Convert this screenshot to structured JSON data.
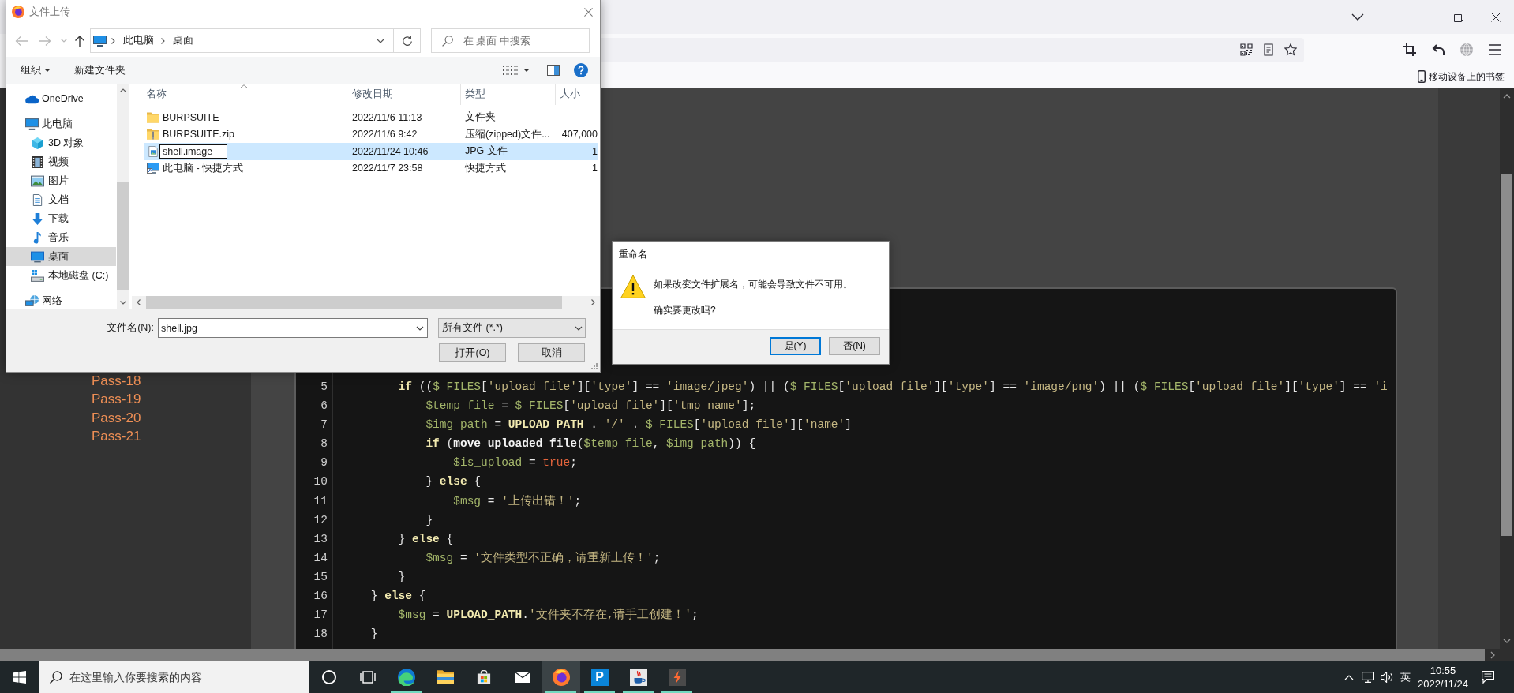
{
  "browser": {
    "bookmarks": [
      {
        "label": "移动设备上的书签"
      }
    ]
  },
  "page": {
    "sidebar": {
      "items": [
        {
          "label": "Pass-18"
        },
        {
          "label": "Pass-19"
        },
        {
          "label": "Pass-20"
        },
        {
          "label": "Pass-21"
        }
      ]
    },
    "code": {
      "lines": [
        {
          "number": "5",
          "tokens": [
            {
              "kind": "keyword",
              "text": "        if"
            },
            {
              "kind": "plain",
              "text": " (("
            },
            {
              "kind": "variable",
              "text": "$_FILES"
            },
            {
              "kind": "plain",
              "text": "["
            },
            {
              "kind": "string",
              "text": "'upload_file'"
            },
            {
              "kind": "plain",
              "text": "]["
            },
            {
              "kind": "string",
              "text": "'type'"
            },
            {
              "kind": "plain",
              "text": "] == "
            },
            {
              "kind": "string",
              "text": "'image/jpeg'"
            },
            {
              "kind": "plain",
              "text": ") || ("
            },
            {
              "kind": "variable",
              "text": "$_FILES"
            },
            {
              "kind": "plain",
              "text": "["
            },
            {
              "kind": "string",
              "text": "'upload_file'"
            },
            {
              "kind": "plain",
              "text": "]["
            },
            {
              "kind": "string",
              "text": "'type'"
            },
            {
              "kind": "plain",
              "text": "] == "
            },
            {
              "kind": "string",
              "text": "'image/png'"
            },
            {
              "kind": "plain",
              "text": ") || ("
            },
            {
              "kind": "variable",
              "text": "$_FILES"
            },
            {
              "kind": "plain",
              "text": "["
            },
            {
              "kind": "string",
              "text": "'upload_file'"
            },
            {
              "kind": "plain",
              "text": "]["
            },
            {
              "kind": "string",
              "text": "'type'"
            },
            {
              "kind": "plain",
              "text": "] == "
            },
            {
              "kind": "string",
              "text": "'i"
            }
          ]
        },
        {
          "number": "6",
          "tokens": [
            {
              "kind": "variable",
              "text": "            $temp_file"
            },
            {
              "kind": "plain",
              "text": " = "
            },
            {
              "kind": "variable",
              "text": "$_FILES"
            },
            {
              "kind": "plain",
              "text": "["
            },
            {
              "kind": "string",
              "text": "'upload_file'"
            },
            {
              "kind": "plain",
              "text": "]["
            },
            {
              "kind": "string",
              "text": "'tmp_name'"
            },
            {
              "kind": "plain",
              "text": "];"
            }
          ]
        },
        {
          "number": "7",
          "tokens": [
            {
              "kind": "variable",
              "text": "            $img_path"
            },
            {
              "kind": "plain",
              "text": " = "
            },
            {
              "kind": "constant",
              "text": "UPLOAD_PATH"
            },
            {
              "kind": "plain",
              "text": " . "
            },
            {
              "kind": "string",
              "text": "'/'"
            },
            {
              "kind": "plain",
              "text": " . "
            },
            {
              "kind": "variable",
              "text": "$_FILES"
            },
            {
              "kind": "plain",
              "text": "["
            },
            {
              "kind": "string",
              "text": "'upload_file'"
            },
            {
              "kind": "plain",
              "text": "]["
            },
            {
              "kind": "string",
              "text": "'name'"
            },
            {
              "kind": "plain",
              "text": "]"
            }
          ]
        },
        {
          "number": "8",
          "tokens": [
            {
              "kind": "keyword",
              "text": "            if"
            },
            {
              "kind": "plain",
              "text": " ("
            },
            {
              "kind": "function",
              "text": "move_uploaded_file"
            },
            {
              "kind": "plain",
              "text": "("
            },
            {
              "kind": "variable",
              "text": "$temp_file"
            },
            {
              "kind": "plain",
              "text": ", "
            },
            {
              "kind": "variable",
              "text": "$img_path"
            },
            {
              "kind": "plain",
              "text": ")) {"
            }
          ]
        },
        {
          "number": "9",
          "tokens": [
            {
              "kind": "variable",
              "text": "                $is_upload"
            },
            {
              "kind": "plain",
              "text": " = "
            },
            {
              "kind": "literal",
              "text": "true"
            },
            {
              "kind": "plain",
              "text": ";"
            }
          ]
        },
        {
          "number": "10",
          "tokens": [
            {
              "kind": "plain",
              "text": "            } "
            },
            {
              "kind": "keyword",
              "text": "else"
            },
            {
              "kind": "plain",
              "text": " {"
            }
          ]
        },
        {
          "number": "11",
          "tokens": [
            {
              "kind": "variable",
              "text": "                $msg"
            },
            {
              "kind": "plain",
              "text": " = "
            },
            {
              "kind": "string",
              "text": "'上传出错！'"
            },
            {
              "kind": "plain",
              "text": ";"
            }
          ]
        },
        {
          "number": "12",
          "tokens": [
            {
              "kind": "plain",
              "text": "            }"
            }
          ]
        },
        {
          "number": "13",
          "tokens": [
            {
              "kind": "plain",
              "text": "        } "
            },
            {
              "kind": "keyword",
              "text": "else"
            },
            {
              "kind": "plain",
              "text": " {"
            }
          ]
        },
        {
          "number": "14",
          "tokens": [
            {
              "kind": "variable",
              "text": "            $msg"
            },
            {
              "kind": "plain",
              "text": " = "
            },
            {
              "kind": "string",
              "text": "'文件类型不正确，请重新上传！'"
            },
            {
              "kind": "plain",
              "text": ";"
            }
          ]
        },
        {
          "number": "15",
          "tokens": [
            {
              "kind": "plain",
              "text": "        }"
            }
          ]
        },
        {
          "number": "16",
          "tokens": [
            {
              "kind": "plain",
              "text": "    } "
            },
            {
              "kind": "keyword",
              "text": "else"
            },
            {
              "kind": "plain",
              "text": " {"
            }
          ]
        },
        {
          "number": "17",
          "tokens": [
            {
              "kind": "variable",
              "text": "        $msg"
            },
            {
              "kind": "plain",
              "text": " = "
            },
            {
              "kind": "constant",
              "text": "UPLOAD_PATH"
            },
            {
              "kind": "plain",
              "text": "."
            },
            {
              "kind": "string",
              "text": "'文件夹不存在,请手工创建！'"
            },
            {
              "kind": "plain",
              "text": ";"
            }
          ]
        },
        {
          "number": "18",
          "tokens": [
            {
              "kind": "plain",
              "text": "    }"
            }
          ]
        }
      ]
    }
  },
  "file_dialog": {
    "title": "文件上传",
    "nav_buttons": [
      {
        "kind": "back",
        "disabled": true
      },
      {
        "kind": "forward",
        "disabled": true
      },
      {
        "kind": "recent",
        "disabled": true
      },
      {
        "kind": "up",
        "disabled": false
      }
    ],
    "breadcrumb": [
      {
        "label": "此电脑"
      },
      {
        "label": "桌面"
      }
    ],
    "search": {
      "placeholder": "在 桌面 中搜索"
    },
    "commands": [
      {
        "label": "组织",
        "menu": true
      },
      {
        "label": "新建文件夹",
        "menu": false
      }
    ],
    "nav": [
      {
        "label": "OneDrive",
        "kind": "cloud",
        "selected": false
      },
      {
        "label": "此电脑",
        "kind": "computer",
        "selected": false,
        "children": [
          {
            "label": "3D 对象",
            "kind": "cube",
            "selected": false
          },
          {
            "label": "视频",
            "kind": "video",
            "selected": false
          },
          {
            "label": "图片",
            "kind": "pictures",
            "selected": false
          },
          {
            "label": "文档",
            "kind": "documents",
            "selected": false
          },
          {
            "label": "下载",
            "kind": "downloads",
            "selected": false
          },
          {
            "label": "音乐",
            "kind": "music",
            "selected": false
          },
          {
            "label": "桌面",
            "kind": "desktop",
            "selected": true
          },
          {
            "label": "本地磁盘 (C:)",
            "kind": "drive",
            "selected": false
          }
        ]
      },
      {
        "label": "网络",
        "kind": "network",
        "selected": false
      }
    ],
    "columns": [
      {
        "label": "名称",
        "sorted": true
      },
      {
        "label": "修改日期",
        "sorted": false
      },
      {
        "label": "类型",
        "sorted": false
      },
      {
        "label": "大小",
        "sorted": false
      }
    ],
    "files": [
      {
        "name": "BURPSUITE",
        "kind": "folder",
        "modified": "2022/11/6 11:13",
        "type": "文件夹",
        "selected": false,
        "editing": false
      },
      {
        "name": "BURPSUITE.zip",
        "kind": "zip",
        "modified": "2022/11/6 9:42",
        "type": "压缩(zipped)文件...",
        "size": "407,000",
        "selected": false,
        "editing": false
      },
      {
        "name": "shell.image",
        "kind": "image",
        "modified": "2022/11/24 10:46",
        "type": "JPG 文件",
        "size": "1",
        "selected": true,
        "editing": true
      },
      {
        "name": "此电脑 - 快捷方式",
        "kind": "shortcut",
        "modified": "2022/11/7 23:58",
        "type": "快捷方式",
        "size": "1",
        "selected": false,
        "editing": false
      }
    ],
    "filename": {
      "label": "文件名(N):",
      "value": "shell.jpg"
    },
    "filetype": {
      "value": "所有文件 (*.*)"
    },
    "buttons": [
      {
        "label": "打开(O)"
      },
      {
        "label": "取消"
      }
    ]
  },
  "rename_dialog": {
    "title": "重命名",
    "message": "如果改变文件扩展名，可能会导致文件不可用。",
    "question": "确实要更改吗?",
    "buttons": [
      {
        "label": "是(Y)",
        "default": true
      },
      {
        "label": "否(N)",
        "default": false
      }
    ]
  },
  "taskbar": {
    "search": {
      "placeholder": "在这里输入你要搜索的内容"
    },
    "apps": [
      {
        "kind": "cortana",
        "selected": false,
        "running": false
      },
      {
        "kind": "taskview",
        "selected": false,
        "running": false
      },
      {
        "kind": "edge",
        "selected": false,
        "running": true
      },
      {
        "kind": "explorer",
        "selected": false,
        "running": false
      },
      {
        "kind": "store",
        "selected": false,
        "running": false
      },
      {
        "kind": "mail",
        "selected": false,
        "running": false
      },
      {
        "kind": "firefox",
        "selected": true,
        "running": true
      },
      {
        "kind": "tile",
        "label": "P",
        "selected": false,
        "running": true
      },
      {
        "kind": "java",
        "selected": false,
        "running": true
      },
      {
        "kind": "burp",
        "selected": false,
        "running": true
      }
    ],
    "input_method": "英",
    "clock": {
      "time": "10:55",
      "date": "2022/11/24"
    }
  }
}
